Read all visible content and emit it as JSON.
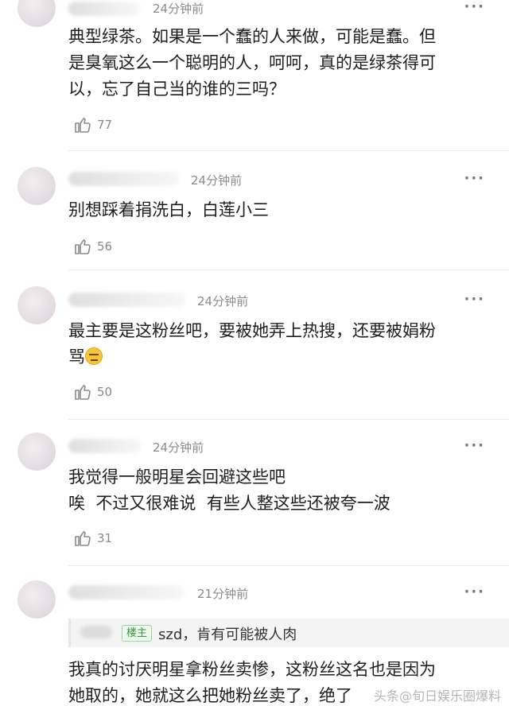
{
  "comments": [
    {
      "time": "24分钟前",
      "more": "···",
      "lines": [
        "典型绿茶。如果是一个蠢的人来做，可能是蠢。但",
        "是臭氧这么一个聪明的人，呵呵，真的是绿茶得可",
        "以，忘了自己当的谁的三吗？"
      ],
      "likes": "77"
    },
    {
      "time": "24分钟前",
      "more": "···",
      "lines": [
        "别想踩着捐洗白，白莲小三"
      ],
      "likes": "56"
    },
    {
      "time": "24分钟前",
      "more": "···",
      "lines": [
        "最主要是这粉丝吧，要被她弄上热搜，还要被娟粉",
        "骂"
      ],
      "likes": "50"
    },
    {
      "time": "24分钟前",
      "more": "···",
      "lines": [
        "我觉得一般明星会回避这些吧",
        "唉  不过又很难说  有些人整这些还被夸一波"
      ],
      "likes": "31"
    },
    {
      "time": "21分钟前",
      "more": "···",
      "reply_badge": "楼主",
      "reply_text": "szd，肯有可能被人肉",
      "lines": [
        "我真的讨厌明星拿粉丝卖惨，这粉丝这名也是因为",
        "她取的，她就这么把她粉丝卖了，绝了"
      ]
    }
  ],
  "watermark": "头条@旬日娱乐圈爆料"
}
